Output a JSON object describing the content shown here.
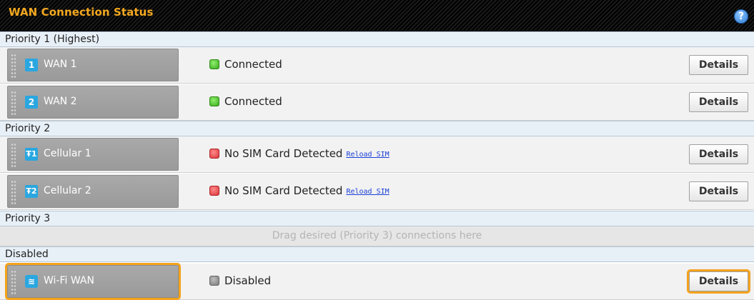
{
  "header": {
    "title": "WAN Connection Status",
    "help_icon": "?"
  },
  "groups": {
    "p1": {
      "label": "Priority 1 (Highest)"
    },
    "p2": {
      "label": "Priority 2"
    },
    "p3": {
      "label": "Priority 3",
      "drop_text": "Drag desired (Priority 3) connections here"
    },
    "disabled": {
      "label": "Disabled"
    }
  },
  "connections": [
    {
      "icon": "1",
      "icon_name": "wan-1-icon",
      "name": "WAN 1",
      "status": "Connected",
      "led": "green",
      "details": "Details"
    },
    {
      "icon": "2",
      "icon_name": "wan-2-icon",
      "name": "WAN 2",
      "status": "Connected",
      "led": "green",
      "details": "Details"
    },
    {
      "icon": "Ŧ1",
      "icon_name": "cellular-1-icon",
      "name": "Cellular 1",
      "status": "No SIM Card Detected",
      "led": "red",
      "link": "Reload SIM",
      "details": "Details"
    },
    {
      "icon": "Ŧ2",
      "icon_name": "cellular-2-icon",
      "name": "Cellular 2",
      "status": "No SIM Card Detected",
      "led": "red",
      "link": "Reload SIM",
      "details": "Details"
    },
    {
      "icon": "≋",
      "icon_name": "wifi-icon",
      "name": "Wi-Fi WAN",
      "status": "Disabled",
      "led": "gray",
      "details": "Details"
    }
  ],
  "colors": {
    "title_text": "#f3a820",
    "highlight": "#f4a31c",
    "status_green": "#3aa81e",
    "status_red": "#d9363a",
    "status_gray": "#7c7c7c",
    "link": "#1a3fd6"
  }
}
